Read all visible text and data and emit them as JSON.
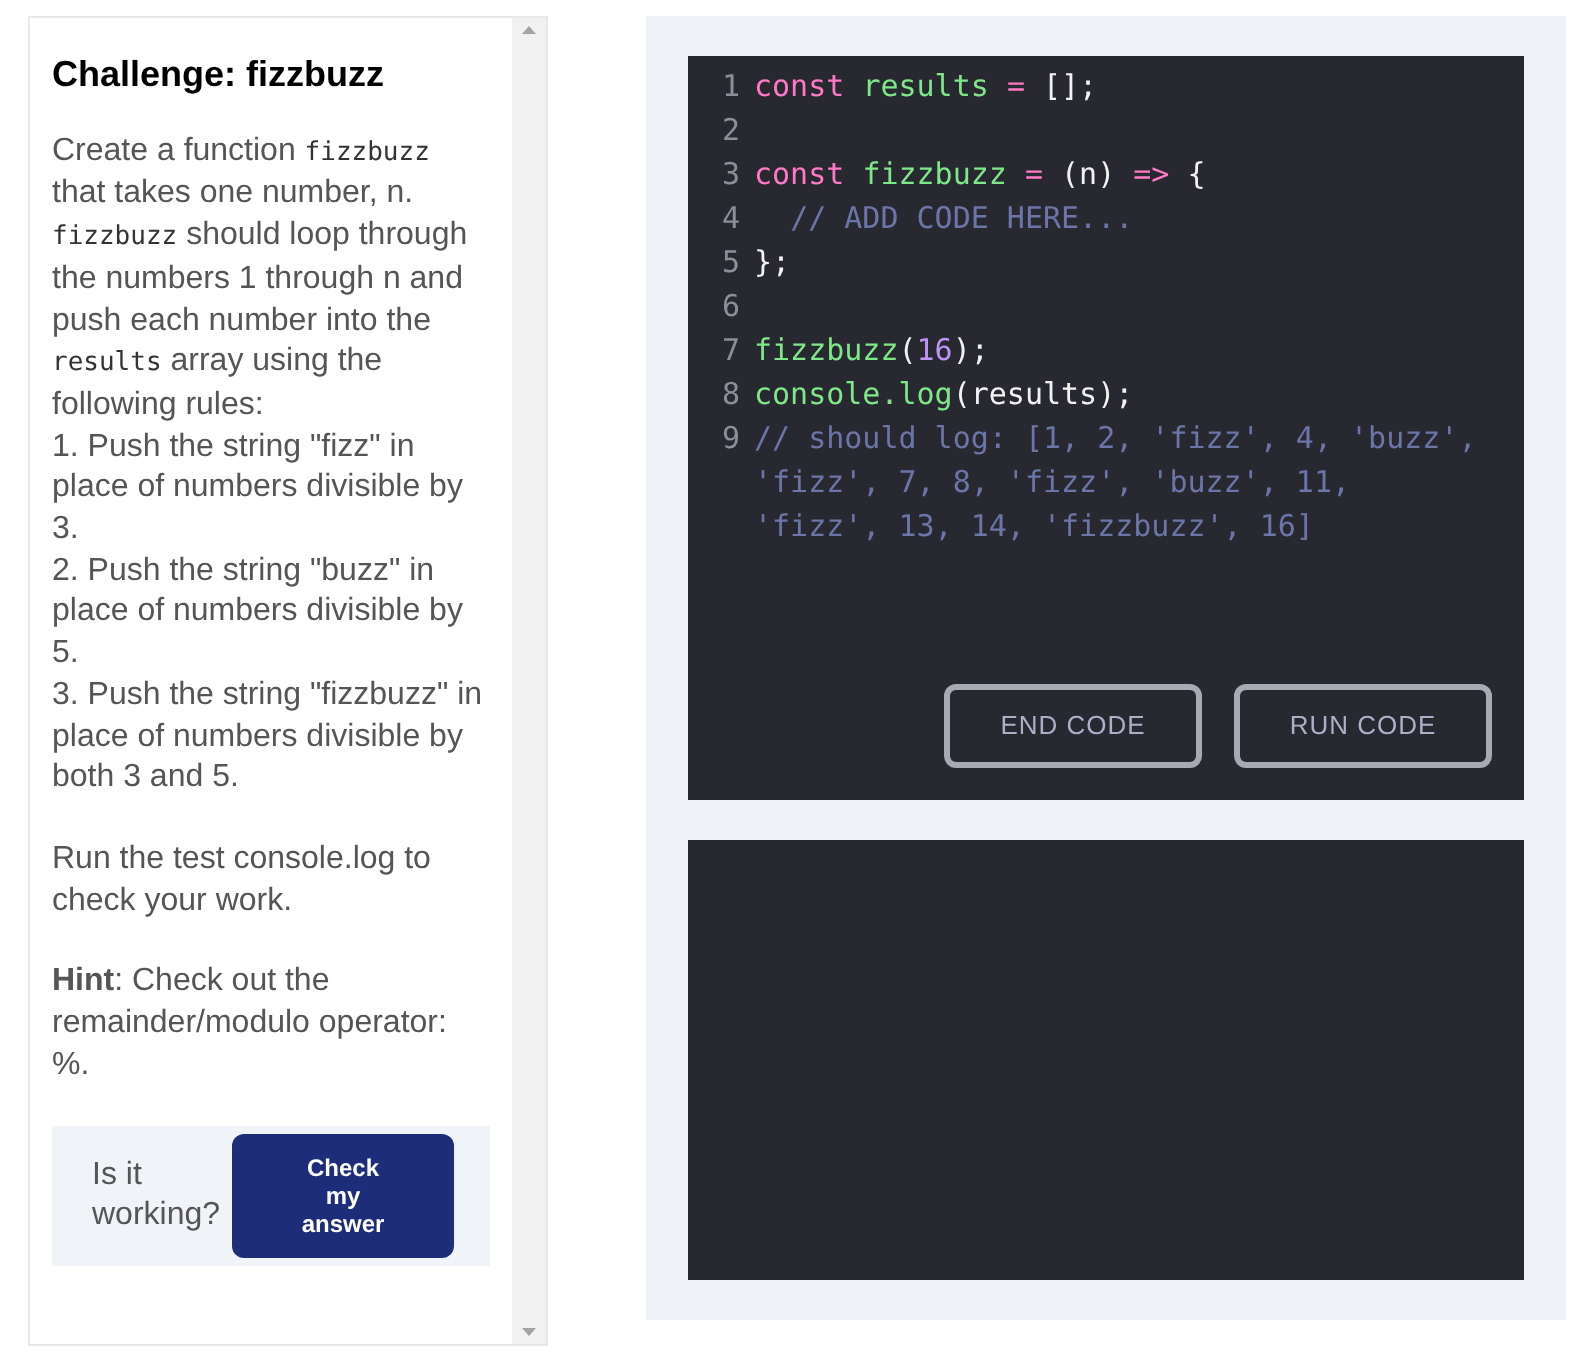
{
  "challenge": {
    "title": "Challenge: fizzbuzz",
    "description": [
      {
        "kind": "text",
        "text": "Create a function "
      },
      {
        "kind": "code",
        "text": "fizzbuzz"
      },
      {
        "kind": "text",
        "text": " that takes one number, n. "
      },
      {
        "kind": "code",
        "text": "fizzbuzz"
      },
      {
        "kind": "text",
        "text": " should loop through the numbers 1 through n and push each number into the "
      },
      {
        "kind": "code",
        "text": "results"
      },
      {
        "kind": "text",
        "text": " array using the following rules:"
      }
    ],
    "rules": [
      "1. Push the string \"fizz\" in place of numbers divisible by 3.",
      "2. Push the string \"buzz\" in place of numbers divisible by 5.",
      "3. Push the string \"fizzbuzz\" in place of numbers divisible by both 3 and 5."
    ],
    "instruction": "Run the test console.log to check your work.",
    "hint": "**Hint**: Check out the remainder/modulo operator: %.",
    "check": {
      "prompt": "Is it working?",
      "button": "Check my answer"
    }
  },
  "editor": {
    "lines": [
      {
        "number": "1",
        "tokens": [
          {
            "kind": "keyword",
            "text": "const "
          },
          {
            "kind": "name",
            "text": "results "
          },
          {
            "kind": "operator",
            "text": "= "
          },
          {
            "kind": "plain",
            "text": "[];"
          }
        ]
      },
      {
        "number": "2"
      },
      {
        "number": "3",
        "tokens": [
          {
            "kind": "keyword",
            "text": "const "
          },
          {
            "kind": "name",
            "text": "fizzbuzz "
          },
          {
            "kind": "operator",
            "text": "= "
          },
          {
            "kind": "plain",
            "text": "(n) "
          },
          {
            "kind": "operator",
            "text": "=> "
          },
          {
            "kind": "plain",
            "text": "{"
          }
        ]
      },
      {
        "number": "4",
        "tokens": [
          {
            "kind": "comment",
            "text": "  // ADD CODE HERE..."
          }
        ]
      },
      {
        "number": "5",
        "tokens": [
          {
            "kind": "plain",
            "text": "};"
          }
        ]
      },
      {
        "number": "6"
      },
      {
        "number": "7",
        "tokens": [
          {
            "kind": "name",
            "text": "fizzbuzz"
          },
          {
            "kind": "plain",
            "text": "("
          },
          {
            "kind": "number",
            "text": "16"
          },
          {
            "kind": "plain",
            "text": ");"
          }
        ]
      },
      {
        "number": "8",
        "tokens": [
          {
            "kind": "name",
            "text": "console.log"
          },
          {
            "kind": "plain",
            "text": "(results);"
          }
        ]
      },
      {
        "number": "9",
        "tokens": [
          {
            "kind": "comment",
            "text": "// should log: [1, 2, 'fizz', 4, 'buzz', 'fizz', 7, 8, 'fizz', 'buzz', 11, 'fizz', 13, 14, 'fizzbuzz', 16]"
          }
        ]
      }
    ],
    "buttons": [
      "END CODE",
      "RUN CODE"
    ]
  }
}
